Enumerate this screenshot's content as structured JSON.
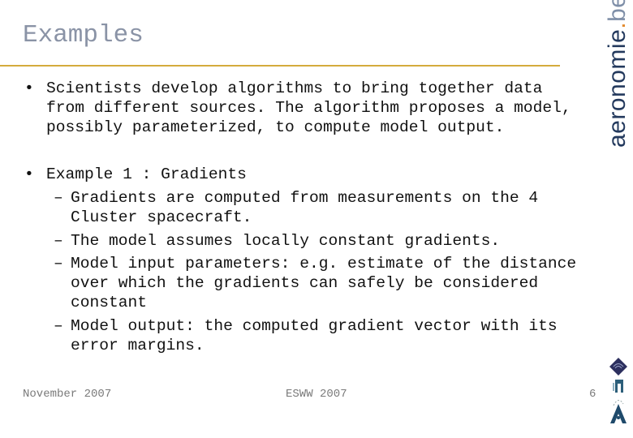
{
  "slide": {
    "title": "Examples",
    "logo_text": {
      "main": "aeronomie",
      "dot": ".",
      "tld": "be"
    },
    "bullets": [
      {
        "lines": [
          "Scientists develop algorithms to bring together data",
          "from different sources. The algorithm proposes a model,",
          "possibly parameterized, to compute model output."
        ]
      },
      {
        "lines": [
          "Example 1 : Gradients"
        ],
        "sub": [
          {
            "lines": [
              "Gradients are computed from measurements on the 4",
              "Cluster spacecraft."
            ]
          },
          {
            "lines": [
              "The model assumes locally constant gradients."
            ]
          },
          {
            "lines": [
              "Model input parameters: e.g. estimate of the distance",
              "over which the gradients can safely be considered",
              "constant"
            ]
          },
          {
            "lines": [
              "Model output: the computed gradient vector with its",
              "error margins."
            ]
          }
        ]
      }
    ],
    "footer": {
      "date": "November 2007",
      "event": "ESWW 2007",
      "page": "6"
    },
    "colors": {
      "title": "#8a93a6",
      "rule": "#d4ab3c",
      "logo": "#23395d"
    }
  }
}
